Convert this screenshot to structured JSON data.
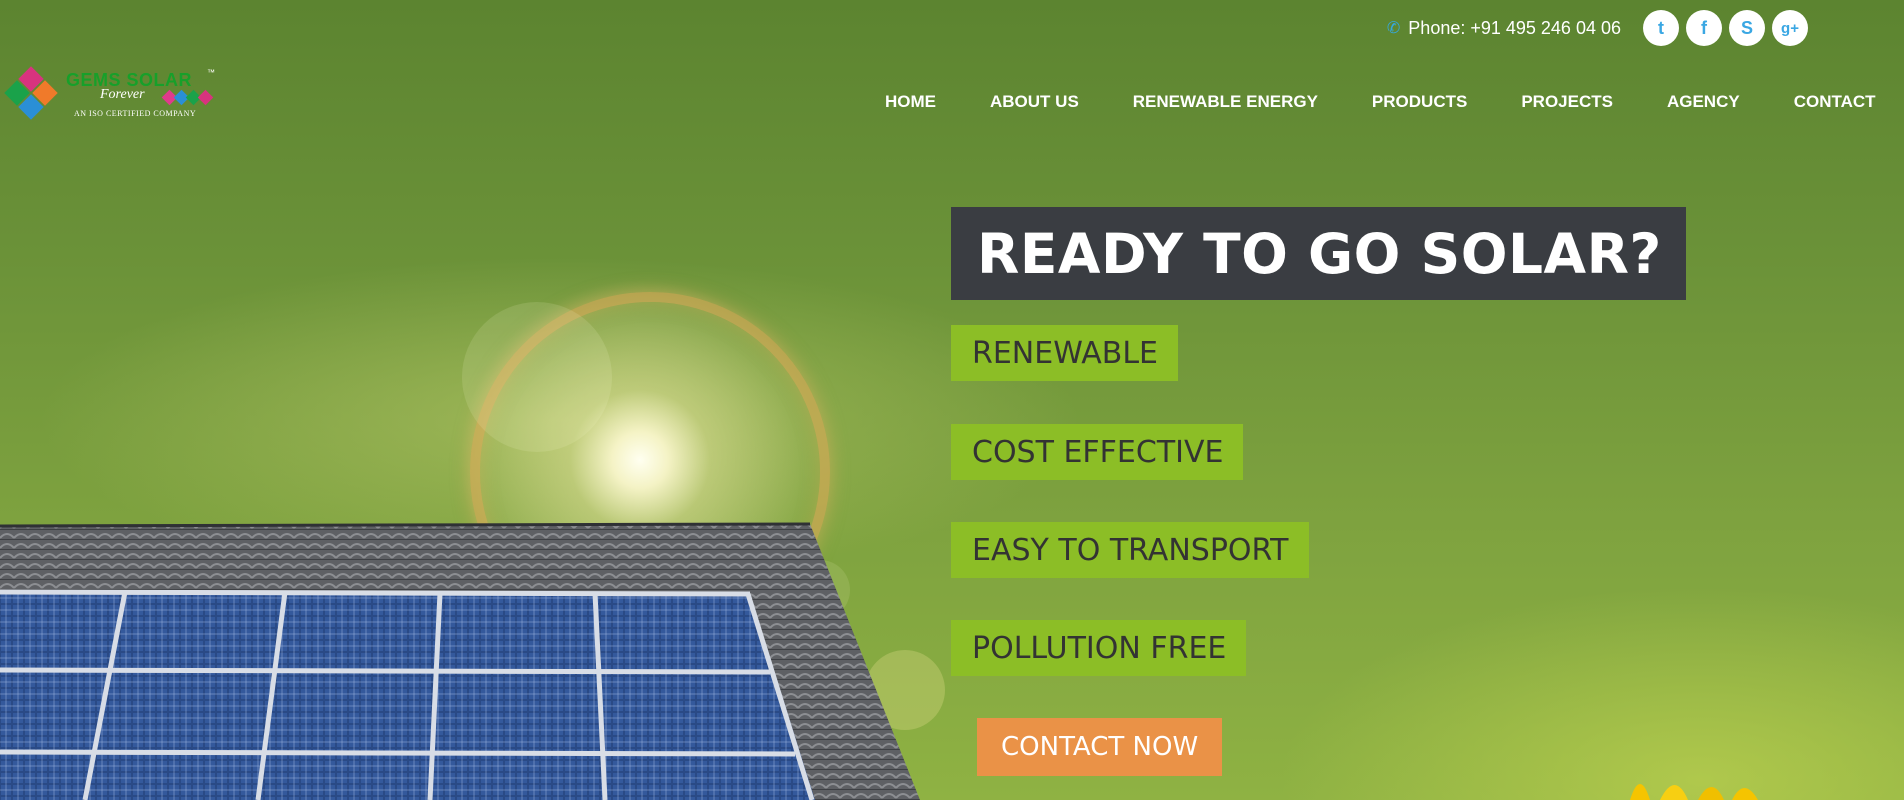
{
  "topbar": {
    "phone_label": "Phone: +91 495 246 04 06",
    "social": [
      {
        "name": "twitter-icon",
        "glyph": "t"
      },
      {
        "name": "facebook-icon",
        "glyph": "f"
      },
      {
        "name": "skype-icon",
        "glyph": "S"
      },
      {
        "name": "google-plus-icon",
        "glyph": "g+"
      }
    ]
  },
  "logo": {
    "name": "GEMS SOLAR",
    "tm": "™",
    "forever": "Forever",
    "tagline": "AN ISO CERTIFIED COMPANY"
  },
  "nav": {
    "items": [
      "HOME",
      "ABOUT US",
      "RENEWABLE ENERGY",
      "PRODUCTS",
      "PROJECTS",
      "AGENCY",
      "CONTACT"
    ]
  },
  "hero": {
    "title": "READY TO GO SOLAR?",
    "features": [
      "RENEWABLE",
      "COST EFFECTIVE",
      "EASY TO TRANSPORT",
      "POLLUTION FREE"
    ],
    "cta_label": "CONTACT NOW"
  },
  "colors": {
    "accent_green": "#8cbe26",
    "title_bg": "#3a3d42",
    "cta_orange": "#ea9247",
    "social_blue": "#3aa7e3"
  }
}
